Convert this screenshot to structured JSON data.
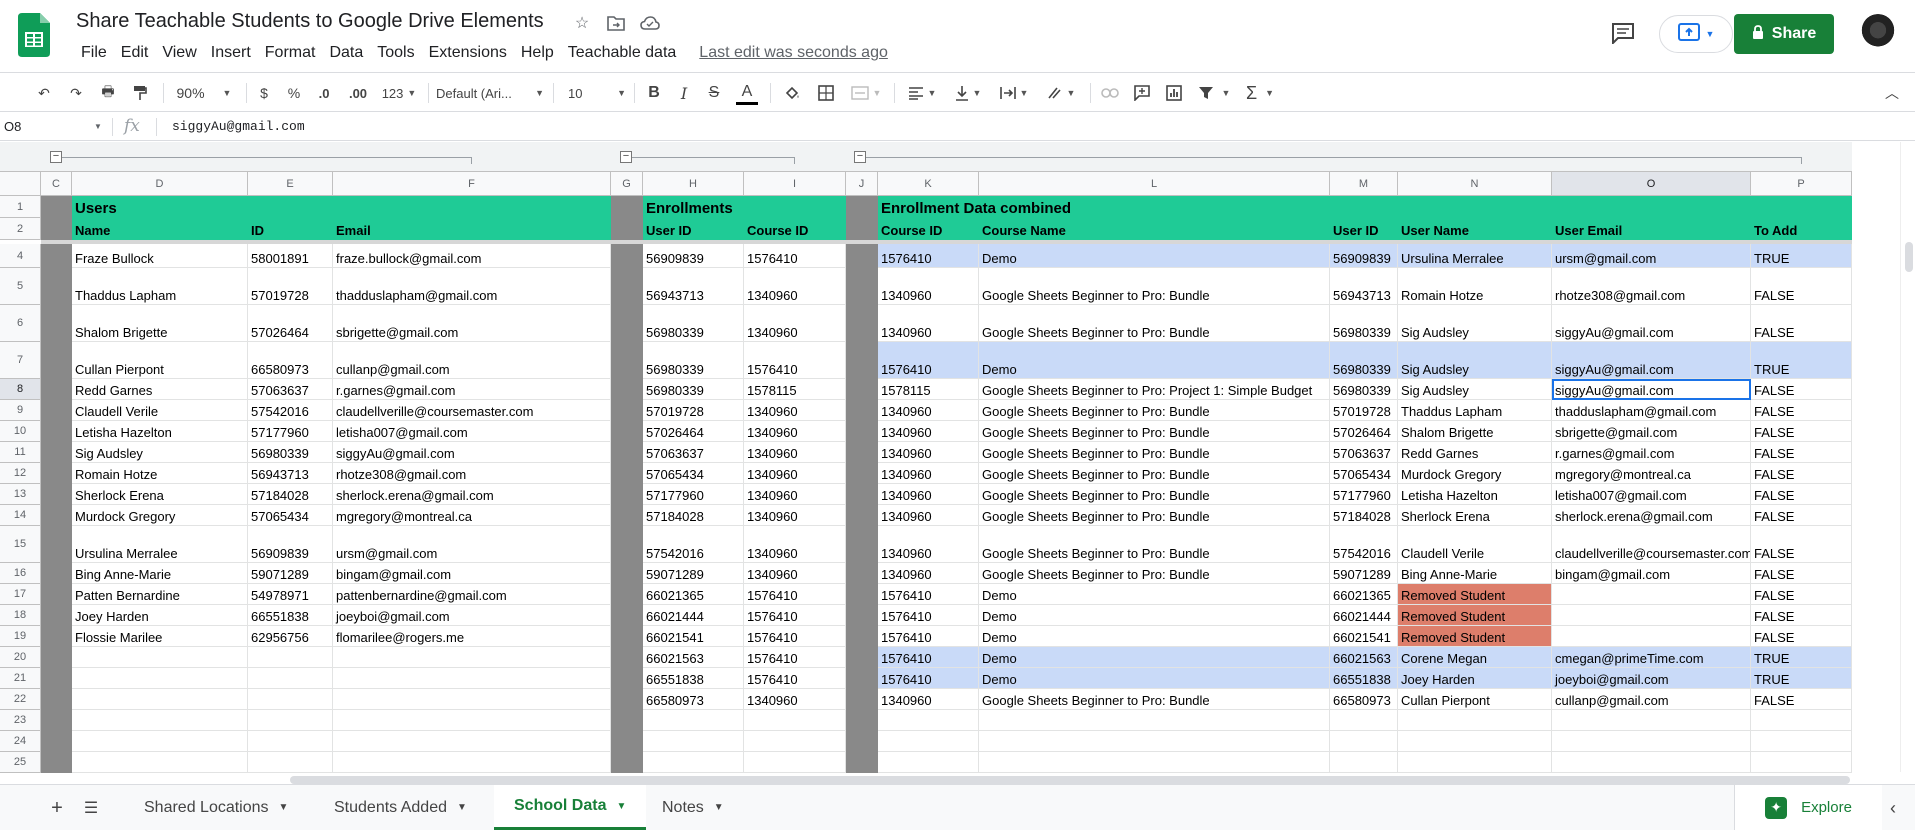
{
  "document": {
    "title": "Share Teachable Students to Google Drive Elements",
    "last_edit": "Last edit was seconds ago",
    "share_label": "Share"
  },
  "menu": [
    "File",
    "Edit",
    "View",
    "Insert",
    "Format",
    "Data",
    "Tools",
    "Extensions",
    "Help",
    "Teachable data"
  ],
  "toolbar": {
    "zoom": "90%",
    "currency": "$",
    "percent": "%",
    "decrease_decimal": ".0",
    "increase_decimal": ".00",
    "more_formats": "123",
    "font": "Default (Ari...",
    "font_size": "10",
    "bold": "B",
    "italic": "I",
    "strike": "S",
    "text_color": "A"
  },
  "formula_bar": {
    "name_box": "O8",
    "fx": "fx",
    "value": "siggyAu@gmail.com"
  },
  "columns": [
    "C",
    "D",
    "E",
    "F",
    "G",
    "H",
    "I",
    "J",
    "K",
    "L",
    "M",
    "N",
    "O",
    "P"
  ],
  "rows": [
    "1",
    "2",
    "4",
    "5",
    "6",
    "7",
    "8",
    "9",
    "10",
    "11",
    "12",
    "13",
    "14",
    "15",
    "16",
    "17",
    "18",
    "19",
    "20",
    "21",
    "22",
    "23",
    "24",
    "25"
  ],
  "sections": {
    "users": "Users",
    "enrollments": "Enrollments",
    "combined": "Enrollment Data combined"
  },
  "headers": {
    "users": [
      "Name",
      "ID",
      "Email"
    ],
    "enrollments": [
      "User ID",
      "Course ID"
    ],
    "combined": [
      "Course ID",
      "Course Name",
      "User ID",
      "User Name",
      "User Email",
      "To Add"
    ]
  },
  "users": [
    [
      "Fraze Bullock",
      "58001891",
      "fraze.bullock@gmail.com"
    ],
    [
      "Thaddus Lapham",
      "57019728",
      "thadduslapham@gmail.com"
    ],
    [
      "Shalom Brigette",
      "57026464",
      "sbrigette@gmail.com"
    ],
    [
      "Cullan Pierpont",
      "66580973",
      "cullanp@gmail.com"
    ],
    [
      "Redd Garnes",
      "57063637",
      "r.garnes@gmail.com"
    ],
    [
      "Claudell Verile",
      "57542016",
      "claudellverille@coursemaster.com"
    ],
    [
      "Letisha Hazelton",
      "57177960",
      "letisha007@gmail.com"
    ],
    [
      "Sig Audsley",
      "56980339",
      "siggyAu@gmail.com"
    ],
    [
      "Romain Hotze",
      "56943713",
      "rhotze308@gmail.com"
    ],
    [
      "Sherlock Erena",
      "57184028",
      "sherlock.erena@gmail.com"
    ],
    [
      "Murdock Gregory",
      "57065434",
      "mgregory@montreal.ca"
    ],
    [
      "Ursulina Merralee",
      "56909839",
      "ursm@gmail.com"
    ],
    [
      "Bing Anne-Marie",
      "59071289",
      "bingam@gmail.com"
    ],
    [
      "Patten Bernardine",
      "54978971",
      "pattenbernardine@gmail.com"
    ],
    [
      "Joey Harden",
      "66551838",
      "joeyboi@gmail.com"
    ],
    [
      "Flossie Marilee",
      "62956756",
      "flomarilee@rogers.me"
    ]
  ],
  "enrollments": [
    [
      "56909839",
      "1576410"
    ],
    [
      "56943713",
      "1340960"
    ],
    [
      "56980339",
      "1340960"
    ],
    [
      "56980339",
      "1576410"
    ],
    [
      "56980339",
      "1578115"
    ],
    [
      "57019728",
      "1340960"
    ],
    [
      "57026464",
      "1340960"
    ],
    [
      "57063637",
      "1340960"
    ],
    [
      "57065434",
      "1340960"
    ],
    [
      "57177960",
      "1340960"
    ],
    [
      "57184028",
      "1340960"
    ],
    [
      "57542016",
      "1340960"
    ],
    [
      "59071289",
      "1340960"
    ],
    [
      "66021365",
      "1576410"
    ],
    [
      "66021444",
      "1576410"
    ],
    [
      "66021541",
      "1576410"
    ],
    [
      "66021563",
      "1576410"
    ],
    [
      "66551838",
      "1576410"
    ],
    [
      "66580973",
      "1340960"
    ]
  ],
  "combined": [
    [
      "1576410",
      "Demo",
      "56909839",
      "Ursulina Merralee",
      "ursm@gmail.com",
      "TRUE"
    ],
    [
      "1340960",
      "Google Sheets Beginner to Pro: Bundle",
      "56943713",
      "Romain Hotze",
      "rhotze308@gmail.com",
      "FALSE"
    ],
    [
      "1340960",
      "Google Sheets Beginner to Pro: Bundle",
      "56980339",
      "Sig Audsley",
      "siggyAu@gmail.com",
      "FALSE"
    ],
    [
      "1576410",
      "Demo",
      "56980339",
      "Sig Audsley",
      "siggyAu@gmail.com",
      "TRUE"
    ],
    [
      "1578115",
      "Google Sheets Beginner to Pro: Project 1: Simple Budget",
      "56980339",
      "Sig Audsley",
      "siggyAu@gmail.com",
      "FALSE"
    ],
    [
      "1340960",
      "Google Sheets Beginner to Pro: Bundle",
      "57019728",
      "Thaddus Lapham",
      "thadduslapham@gmail.com",
      "FALSE"
    ],
    [
      "1340960",
      "Google Sheets Beginner to Pro: Bundle",
      "57026464",
      "Shalom Brigette",
      "sbrigette@gmail.com",
      "FALSE"
    ],
    [
      "1340960",
      "Google Sheets Beginner to Pro: Bundle",
      "57063637",
      "Redd Garnes",
      "r.garnes@gmail.com",
      "FALSE"
    ],
    [
      "1340960",
      "Google Sheets Beginner to Pro: Bundle",
      "57065434",
      "Murdock Gregory",
      "mgregory@montreal.ca",
      "FALSE"
    ],
    [
      "1340960",
      "Google Sheets Beginner to Pro: Bundle",
      "57177960",
      "Letisha Hazelton",
      "letisha007@gmail.com",
      "FALSE"
    ],
    [
      "1340960",
      "Google Sheets Beginner to Pro: Bundle",
      "57184028",
      "Sherlock Erena",
      "sherlock.erena@gmail.com",
      "FALSE"
    ],
    [
      "1340960",
      "Google Sheets Beginner to Pro: Bundle",
      "57542016",
      "Claudell Verile",
      "claudellverille@coursemaster.com",
      "FALSE"
    ],
    [
      "1340960",
      "Google Sheets Beginner to Pro: Bundle",
      "59071289",
      "Bing Anne-Marie",
      "bingam@gmail.com",
      "FALSE"
    ],
    [
      "1576410",
      "Demo",
      "66021365",
      "Removed Student",
      "",
      "FALSE"
    ],
    [
      "1576410",
      "Demo",
      "66021444",
      "Removed Student",
      "",
      "FALSE"
    ],
    [
      "1576410",
      "Demo",
      "66021541",
      "Removed Student",
      "",
      "FALSE"
    ],
    [
      "1576410",
      "Demo",
      "66021563",
      "Corene Megan",
      "cmegan@primeTime.com",
      "TRUE"
    ],
    [
      "1576410",
      "Demo",
      "66551838",
      "Joey Harden",
      "joeyboi@gmail.com",
      "TRUE"
    ],
    [
      "1340960",
      "Google Sheets Beginner to Pro: Bundle",
      "66580973",
      "Cullan Pierpont",
      "cullanp@gmail.com",
      "FALSE"
    ]
  ],
  "sheet_tabs": [
    "Shared Locations",
    "Students Added",
    "School Data",
    "Notes"
  ],
  "active_tab": "School Data",
  "explore_label": "Explore",
  "colors": {
    "header_green": "#1fcb96",
    "highlight_blue": "#c9daf8",
    "removed_red": "#dd7e6b",
    "share_green": "#188038",
    "separator_gray": "#898989"
  },
  "icons": [
    "star-icon",
    "move-icon",
    "cloud-status-icon",
    "comment-icon",
    "present-icon",
    "lock-icon",
    "undo-icon",
    "redo-icon",
    "print-icon",
    "paint-format-icon",
    "fill-color-icon",
    "borders-icon",
    "merge-icon",
    "align-icon",
    "valign-icon",
    "wrap-icon",
    "rotate-icon",
    "link-icon",
    "insert-comment-icon",
    "chart-icon",
    "filter-icon",
    "functions-icon",
    "collapse-icon",
    "add-sheet-icon",
    "all-sheets-icon"
  ]
}
